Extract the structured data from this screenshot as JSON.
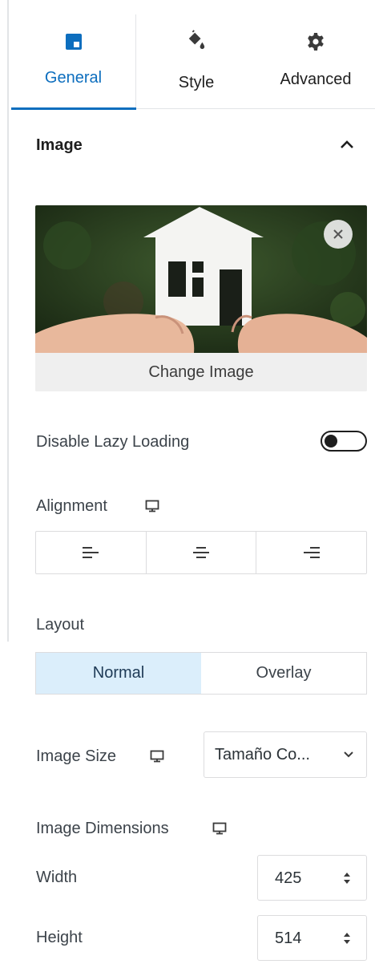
{
  "tabs": [
    {
      "label": "General",
      "icon": "layout-block-icon",
      "active": true
    },
    {
      "label": "Style",
      "icon": "paint-bucket-icon",
      "active": false
    },
    {
      "label": "Advanced",
      "icon": "gear-icon",
      "active": false
    }
  ],
  "section": {
    "title": "Image"
  },
  "image": {
    "change_label": "Change Image"
  },
  "lazy_loading": {
    "label": "Disable Lazy Loading",
    "enabled": false
  },
  "alignment": {
    "label": "Alignment"
  },
  "layout": {
    "label": "Layout",
    "options": [
      "Normal",
      "Overlay"
    ],
    "selected": "Normal"
  },
  "image_size": {
    "label": "Image Size",
    "value": "Tamaño Co..."
  },
  "dimensions": {
    "label": "Image Dimensions",
    "width_label": "Width",
    "width_value": "425",
    "height_label": "Height",
    "height_value": "514"
  },
  "colors": {
    "accent": "#0d6ebe",
    "active_segment": "#dbeefb",
    "border": "#dcdcde"
  }
}
